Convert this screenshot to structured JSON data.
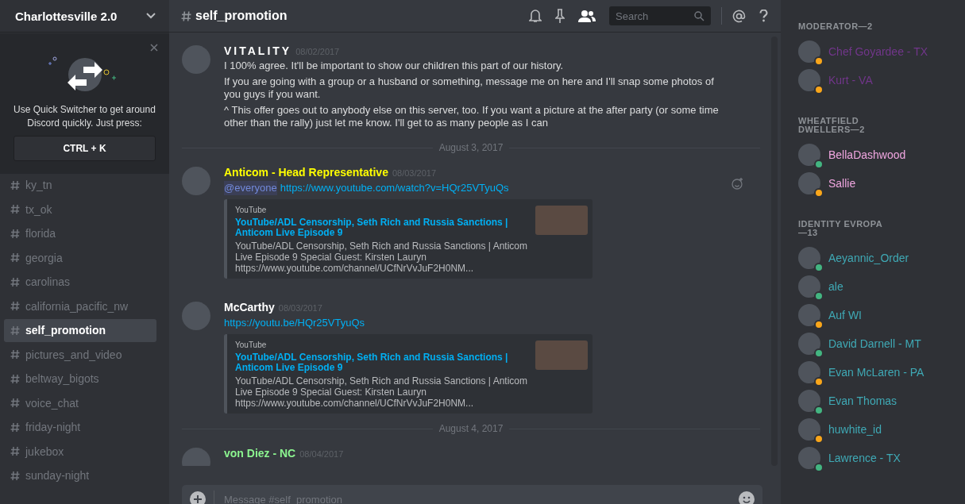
{
  "server": {
    "name": "Charlottesville 2.0"
  },
  "quick_switcher": {
    "text": "Use Quick Switcher to get around Discord quickly. Just press:",
    "shortcut": "CTRL + K"
  },
  "channels": [
    {
      "name": "ky_tn",
      "selected": false
    },
    {
      "name": "tx_ok",
      "selected": false
    },
    {
      "name": "florida",
      "selected": false
    },
    {
      "name": "georgia",
      "selected": false
    },
    {
      "name": "carolinas",
      "selected": false
    },
    {
      "name": "california_pacific_nw",
      "selected": false
    },
    {
      "name": "self_promotion",
      "selected": true
    },
    {
      "name": "pictures_and_video",
      "selected": false
    },
    {
      "name": "beltway_bigots",
      "selected": false
    },
    {
      "name": "voice_chat",
      "selected": false
    },
    {
      "name": "friday-night",
      "selected": false
    },
    {
      "name": "jukebox",
      "selected": false
    },
    {
      "name": "sunday-night",
      "selected": false
    }
  ],
  "header": {
    "channel": "self_promotion",
    "search_placeholder": "Search"
  },
  "feed": [
    {
      "kind": "message",
      "author": "VITALITY",
      "spaced": true,
      "color": "#ffffff",
      "date": "08/02/2017",
      "lines": [
        "I 100% agree. It'll be important to show our children this part of our history.",
        "If you are going with a group or a husband or something, message me on here and I'll snap some photos of you guys if you want.",
        "^ This offer goes out to anybody else on this server, too. If you want a picture at the after party (or some time other than the rally) just let me know. I'll get to as many people as I can"
      ]
    },
    {
      "kind": "divider",
      "text": "August 3, 2017"
    },
    {
      "kind": "message",
      "author": "Anticom - Head Representative",
      "spaced": false,
      "color": "#ffff00",
      "date": "08/03/2017",
      "mention": "@everyone",
      "link": "https://www.youtube.com/watch?v=HQr25VTyuQs",
      "embed": {
        "provider": "YouTube",
        "title": "YouTube/ADL Censorship, Seth Rich and Russia Sanctions | Anticom Live Episode 9",
        "description": "YouTube/ADL Censorship, Seth Rich and Russia Sanctions | Anticom Live Episode 9 Special Guest: Kirsten Lauryn https://www.youtube.com/channel/UCfNrVvJuF2H0NM..."
      }
    },
    {
      "kind": "message",
      "author": "McCarthy",
      "spaced": false,
      "color": "#ffffff",
      "date": "08/03/2017",
      "link": "https://youtu.be/HQr25VTyuQs",
      "embed": {
        "provider": "YouTube",
        "title": "YouTube/ADL Censorship, Seth Rich and Russia Sanctions | Anticom Live Episode 9",
        "description": "YouTube/ADL Censorship, Seth Rich and Russia Sanctions | Anticom Live Episode 9 Special Guest: Kirsten Lauryn https://www.youtube.com/channel/UCfNrVvJuF2H0NM..."
      }
    },
    {
      "kind": "divider",
      "text": "August 4, 2017"
    },
    {
      "kind": "message",
      "author": "von Diez - NC",
      "spaced": false,
      "color": "#8cf590",
      "date": "08/04/2017"
    }
  ],
  "composer": {
    "placeholder": "Message #self_promotion"
  },
  "member_groups": [
    {
      "title": "MODERATOR—2",
      "color": "#71368a",
      "members": [
        {
          "name": "Chef Goyardee - TX",
          "idle": true
        },
        {
          "name": "Kurt - VA",
          "idle": true
        }
      ]
    },
    {
      "title": "WHEATFIELD DWELLERS—2",
      "color": "#f0a6e0",
      "members": [
        {
          "name": "BellaDashwood",
          "idle": false
        },
        {
          "name": "Sallie",
          "idle": true
        }
      ]
    },
    {
      "title": "IDENTITY EVROPA—13",
      "color": "#3fa9b5",
      "members": [
        {
          "name": "Aeyannic_Order",
          "idle": false
        },
        {
          "name": "ale",
          "idle": false
        },
        {
          "name": "Auf WI",
          "idle": true
        },
        {
          "name": "David Darnell - MT",
          "idle": false
        },
        {
          "name": "Evan McLaren - PA",
          "idle": true
        },
        {
          "name": "Evan Thomas",
          "idle": false
        },
        {
          "name": "huwhite_id",
          "idle": true
        },
        {
          "name": "Lawrence - TX",
          "idle": false
        }
      ]
    }
  ]
}
